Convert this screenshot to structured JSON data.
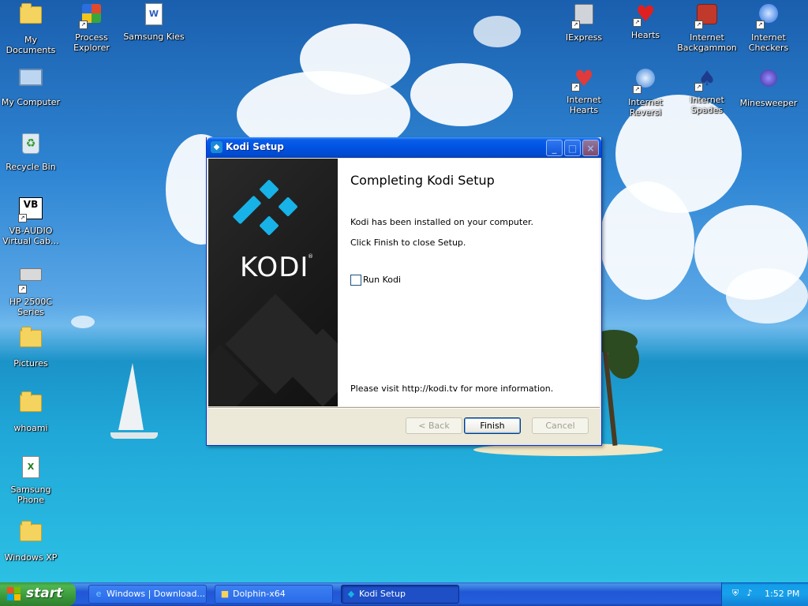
{
  "desktop": {
    "icons_left": [
      {
        "label": "My Documents",
        "icon": "my-documents-icon"
      },
      {
        "label": "My Computer",
        "icon": "my-computer-icon"
      },
      {
        "label": "Recycle Bin",
        "icon": "recycle-bin-icon"
      },
      {
        "label": "VB-AUDIO Virtual Cab…",
        "icon": "vb-audio-icon",
        "glyph": "VB"
      },
      {
        "label": "HP 2500C Series",
        "icon": "printer-icon"
      },
      {
        "label": "Pictures",
        "icon": "folder-icon"
      },
      {
        "label": "whoami",
        "icon": "folder-icon"
      },
      {
        "label": "Samsung Phone",
        "icon": "excel-file-icon"
      },
      {
        "label": "Windows XP",
        "icon": "folder-icon"
      }
    ],
    "icons_top": [
      {
        "label": "Process Explorer",
        "icon": "process-explorer-icon"
      },
      {
        "label": "Samsung Kies",
        "icon": "word-document-icon"
      }
    ],
    "icons_right": [
      {
        "label": "IExpress",
        "icon": "iexpress-icon"
      },
      {
        "label": "Hearts",
        "icon": "hearts-icon"
      },
      {
        "label": "Internet Backgammon",
        "icon": "internet-backgammon-icon"
      },
      {
        "label": "Internet Checkers",
        "icon": "internet-checkers-icon"
      },
      {
        "label": "Internet Hearts",
        "icon": "internet-hearts-icon"
      },
      {
        "label": "Internet Reversi",
        "icon": "internet-reversi-icon"
      },
      {
        "label": "Internet Spades",
        "icon": "internet-spades-icon"
      },
      {
        "label": "Minesweeper",
        "icon": "minesweeper-icon"
      }
    ]
  },
  "dialog": {
    "title": "Kodi Setup",
    "logo_text": "KODI",
    "logo_mark": "®",
    "heading": "Completing Kodi Setup",
    "line1": "Kodi has been installed on your computer.",
    "line2": "Click Finish to close Setup.",
    "checkbox_label": "Run Kodi",
    "checkbox_checked": false,
    "visit_text": "Please visit http://kodi.tv for more information.",
    "buttons": {
      "back": "< Back",
      "finish": "Finish",
      "cancel": "Cancel"
    },
    "title_controls": {
      "minimize": "_",
      "maximize": "□",
      "close": "×"
    }
  },
  "taskbar": {
    "start_label": "start",
    "tasks": [
      {
        "label": "Windows | Download...",
        "icon": "ie-icon"
      },
      {
        "label": "Dolphin-x64",
        "icon": "folder-icon"
      },
      {
        "label": "Kodi Setup",
        "icon": "kodi-icon",
        "active": true
      }
    ],
    "clock": "1:52 PM"
  },
  "colors": {
    "titlebar": "#0054e3",
    "kodi_blue": "#17b2e7",
    "start_green": "#3a983a",
    "taskbar_blue": "#245edb"
  }
}
